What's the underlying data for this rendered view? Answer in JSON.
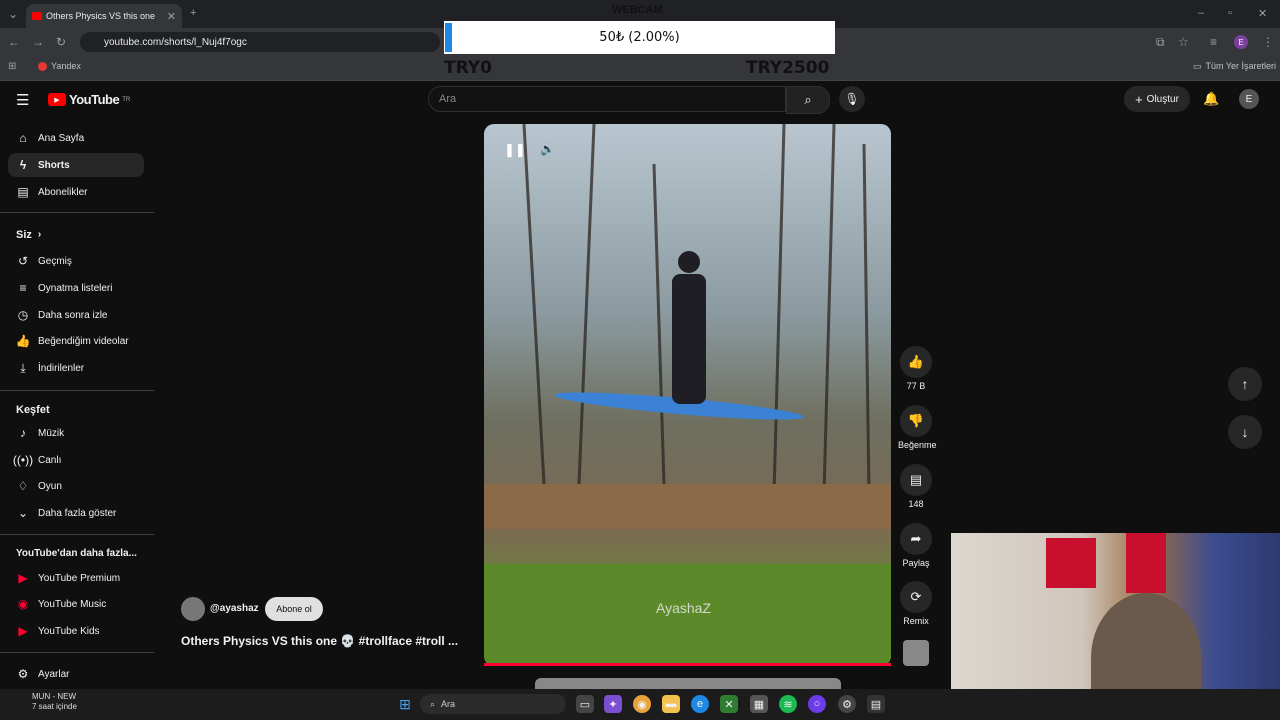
{
  "browser": {
    "tab_title": "Others Physics VS this one",
    "url": "youtube.com/shorts/l_Nuj4f7ogc",
    "bookmark": "Yandex",
    "all_bookmarks": "Tüm Yer İşaretleri",
    "profile_initial": "E"
  },
  "overlay": {
    "webcam_label": "WEBCAM",
    "donation_text": "50₺ (2.00%)",
    "progress_percent": 2.0,
    "goal_min": "TRY0",
    "goal_max": "TRY2500"
  },
  "youtube": {
    "logo": "YouTube",
    "region": "TR",
    "search_placeholder": "Ara",
    "create_label": "Oluştur",
    "avatar_initial": "E"
  },
  "sidebar": {
    "main": [
      {
        "label": "Ana Sayfa",
        "icon": "home-icon"
      },
      {
        "label": "Shorts",
        "icon": "shorts-icon"
      },
      {
        "label": "Abonelikler",
        "icon": "subscriptions-icon"
      }
    ],
    "you_heading": "Siz",
    "you": [
      {
        "label": "Geçmiş",
        "icon": "history-icon"
      },
      {
        "label": "Oynatma listeleri",
        "icon": "playlist-icon"
      },
      {
        "label": "Daha sonra izle",
        "icon": "clock-icon"
      },
      {
        "label": "Beğendiğim videolar",
        "icon": "like-icon"
      },
      {
        "label": "İndirilenler",
        "icon": "download-icon"
      }
    ],
    "explore_heading": "Keşfet",
    "explore": [
      {
        "label": "Müzik",
        "icon": "music-icon"
      },
      {
        "label": "Canlı",
        "icon": "live-icon"
      },
      {
        "label": "Oyun",
        "icon": "game-icon"
      },
      {
        "label": "Daha fazla göster",
        "icon": "chevron-down-icon"
      }
    ],
    "more_heading": "YouTube'dan daha fazla...",
    "more": [
      {
        "label": "YouTube Premium",
        "icon": "youtube-premium-icon"
      },
      {
        "label": "YouTube Music",
        "icon": "youtube-music-icon"
      },
      {
        "label": "YouTube Kids",
        "icon": "youtube-kids-icon"
      }
    ],
    "settings": "Ayarlar"
  },
  "short": {
    "watermark": "AyashaZ",
    "likes": "77 B",
    "dislike_label": "Beğenme",
    "comments": "148",
    "share_label": "Paylaş",
    "remix_label": "Remix",
    "channel": "@ayashaz",
    "subscribe_label": "Abone ol",
    "title": "Others Physics VS this one 💀 #trollface #troll ..."
  },
  "taskbar": {
    "weather_line1": "MUN - NEW",
    "weather_line2": "7 saat içinde",
    "search_placeholder": "Ara"
  }
}
